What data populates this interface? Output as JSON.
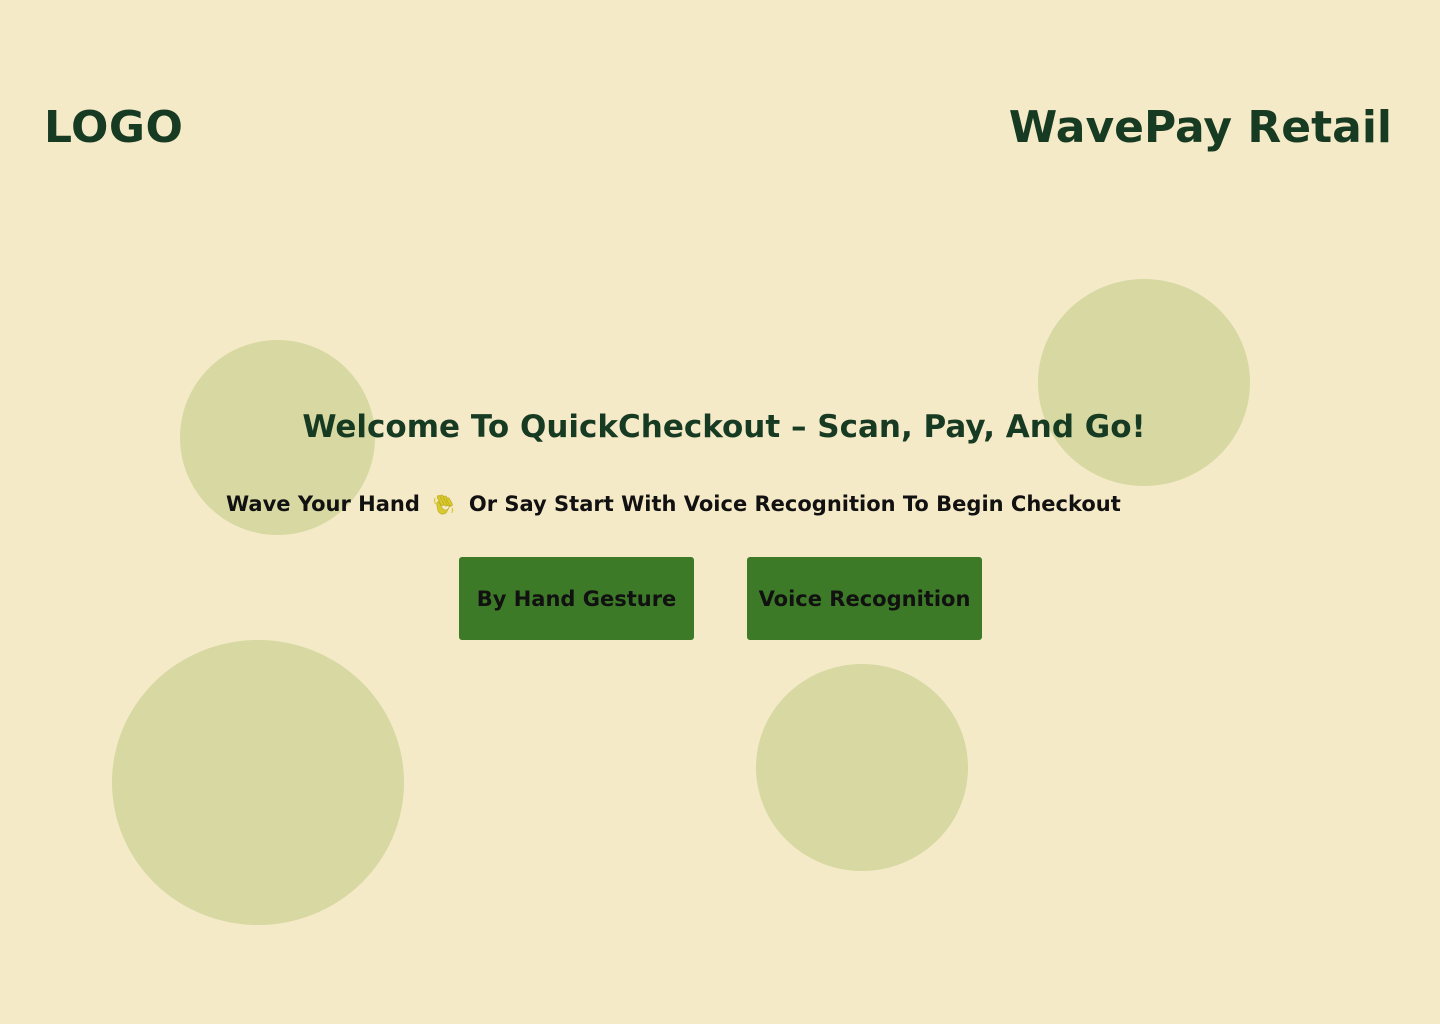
{
  "header": {
    "logo": "LOGO",
    "brand": "WavePay Retail"
  },
  "main": {
    "welcome": "Welcome To QuickCheckout – Scan, Pay, And Go!",
    "instruction_start": "Wave Your Hand",
    "instruction_end": "Or Say Start With Voice Recognition To Begin Checkout",
    "wave_icon": "waving-hand-icon",
    "buttons": {
      "hand_gesture": "By Hand Gesture",
      "voice_recognition": "Voice Recognition"
    }
  },
  "colors": {
    "background": "#f5eac8",
    "circle": "#d7d8a2",
    "heading": "#163a22",
    "button": "#3d7a27",
    "wave_icon": "#d8c92c"
  }
}
